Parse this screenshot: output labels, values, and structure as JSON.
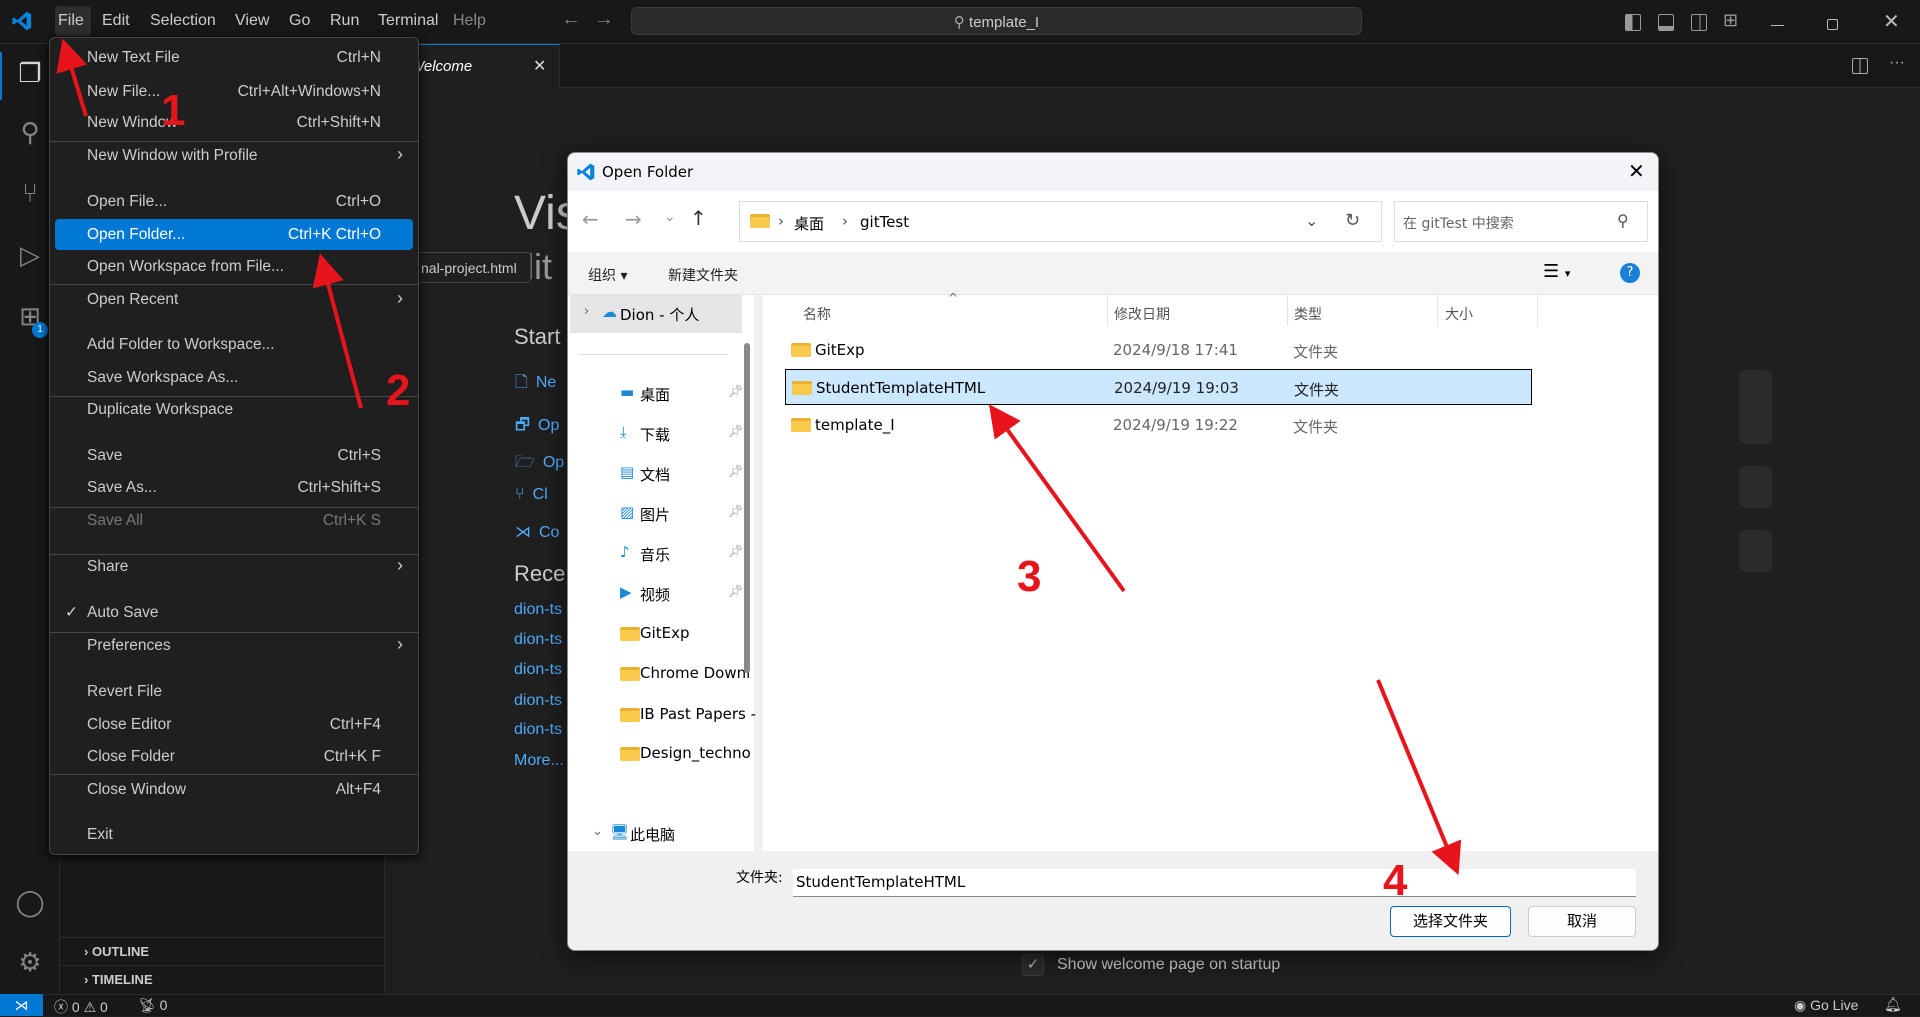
{
  "titlebar": {
    "menus": [
      "File",
      "Edit",
      "Selection",
      "View",
      "Go",
      "Run",
      "Terminal",
      "Help"
    ],
    "search": "template_I"
  },
  "tab": {
    "label": "Welcome"
  },
  "welcome": {
    "title_partial": "Vis",
    "subtitle_partial": "dit",
    "start": "Start",
    "start_links": [
      "Ne",
      "Op",
      "Op",
      "Cl",
      "Co"
    ],
    "recent": "Rece",
    "recent_items": [
      "dion-ts",
      "dion-ts",
      "dion-ts",
      "dion-ts",
      "dion-ts"
    ],
    "more": "More...",
    "tooltip": "nal-project.html",
    "show_on_startup": "Show welcome page on startup"
  },
  "sidebar": {
    "outline": "OUTLINE",
    "timeline": "TIMELINE"
  },
  "activity": {
    "extensions_badge": "1"
  },
  "file_menu": {
    "items": [
      {
        "label": "New Text File",
        "shortcut": "Ctrl+N"
      },
      {
        "label": "New File...",
        "shortcut": "Ctrl+Alt+Windows+N"
      },
      {
        "label": "New Window",
        "shortcut": "Ctrl+Shift+N"
      },
      {
        "label": "New Window with Profile",
        "submenu": true
      },
      {
        "label": "Open File...",
        "shortcut": "Ctrl+O"
      },
      {
        "label": "Open Folder...",
        "shortcut": "Ctrl+K Ctrl+O",
        "selected": true
      },
      {
        "label": "Open Workspace from File..."
      },
      {
        "label": "Open Recent",
        "submenu": true
      },
      {
        "label": "Add Folder to Workspace..."
      },
      {
        "label": "Save Workspace As..."
      },
      {
        "label": "Duplicate Workspace"
      },
      {
        "label": "Save",
        "shortcut": "Ctrl+S"
      },
      {
        "label": "Save As...",
        "shortcut": "Ctrl+Shift+S"
      },
      {
        "label": "Save All",
        "shortcut": "Ctrl+K S",
        "disabled": true
      },
      {
        "label": "Share",
        "submenu": true
      },
      {
        "label": "Auto Save",
        "checked": true
      },
      {
        "label": "Preferences",
        "submenu": true
      },
      {
        "label": "Revert File"
      },
      {
        "label": "Close Editor",
        "shortcut": "Ctrl+F4"
      },
      {
        "label": "Close Folder",
        "shortcut": "Ctrl+K F"
      },
      {
        "label": "Close Window",
        "shortcut": "Alt+F4"
      },
      {
        "label": "Exit"
      }
    ]
  },
  "dialog": {
    "title": "Open Folder",
    "breadcrumb": [
      "桌面",
      "gitTest"
    ],
    "search_placeholder": "在 gitTest 中搜索",
    "organize": "组织",
    "new_folder": "新建文件夹",
    "nav": [
      {
        "label": "Dion - 个人",
        "icon": "onedrive-icon"
      },
      {
        "label": "桌面",
        "icon": "desktop-icon",
        "pinned": true
      },
      {
        "label": "下载",
        "icon": "download-icon",
        "pinned": true
      },
      {
        "label": "文档",
        "icon": "document-icon",
        "pinned": true
      },
      {
        "label": "图片",
        "icon": "pictures-icon",
        "pinned": true
      },
      {
        "label": "音乐",
        "icon": "music-icon",
        "pinned": true
      },
      {
        "label": "视频",
        "icon": "video-icon",
        "pinned": true
      },
      {
        "label": "GitExp",
        "icon": "folder-icon"
      },
      {
        "label": "Chrome Downl",
        "icon": "folder-icon"
      },
      {
        "label": "IB Past Papers -",
        "icon": "folder-icon"
      },
      {
        "label": "Design_techno",
        "icon": "folder-icon"
      },
      {
        "label": "此电脑",
        "icon": "computer-icon"
      }
    ],
    "columns": [
      "名称",
      "修改日期",
      "类型",
      "大小"
    ],
    "rows": [
      {
        "name": "GitExp",
        "date": "2024/9/18 17:41",
        "type": "文件夹"
      },
      {
        "name": "StudentTemplateHTML",
        "date": "2024/9/19 19:03",
        "type": "文件夹",
        "selected": true
      },
      {
        "name": "template_I",
        "date": "2024/9/19 19:22",
        "type": "文件夹"
      }
    ],
    "folder_label": "文件夹:",
    "folder_value": "StudentTemplateHTML",
    "select_button": "选择文件夹",
    "cancel_button": "取消"
  },
  "statusbar": {
    "errors": "0",
    "warnings": "0",
    "ports": "0",
    "golive": "Go Live"
  },
  "annotations": [
    "1",
    "2",
    "3",
    "4"
  ],
  "colors": {
    "accent": "#0078d4",
    "annotation": "#e8141c",
    "selection": "#cce8ff"
  }
}
